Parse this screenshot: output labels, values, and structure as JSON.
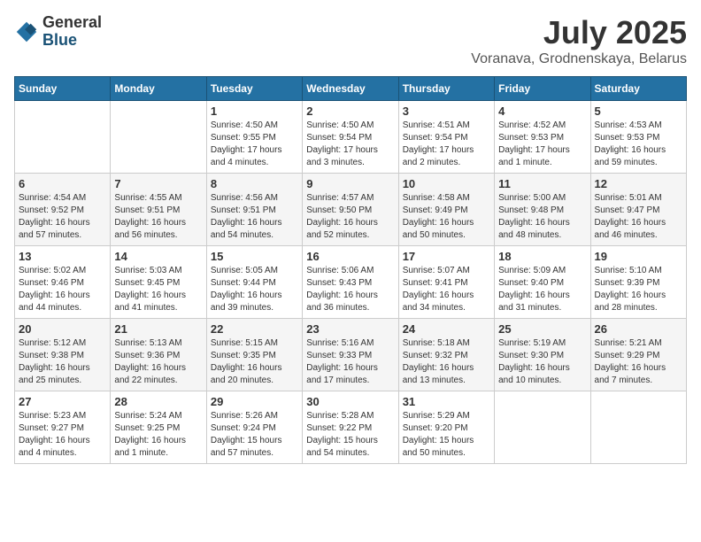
{
  "logo": {
    "general": "General",
    "blue": "Blue"
  },
  "title": "July 2025",
  "location": "Voranava, Grodnenskaya, Belarus",
  "weekdays": [
    "Sunday",
    "Monday",
    "Tuesday",
    "Wednesday",
    "Thursday",
    "Friday",
    "Saturday"
  ],
  "weeks": [
    [
      {
        "day": "",
        "info": ""
      },
      {
        "day": "",
        "info": ""
      },
      {
        "day": "1",
        "info": "Sunrise: 4:50 AM\nSunset: 9:55 PM\nDaylight: 17 hours\nand 4 minutes."
      },
      {
        "day": "2",
        "info": "Sunrise: 4:50 AM\nSunset: 9:54 PM\nDaylight: 17 hours\nand 3 minutes."
      },
      {
        "day": "3",
        "info": "Sunrise: 4:51 AM\nSunset: 9:54 PM\nDaylight: 17 hours\nand 2 minutes."
      },
      {
        "day": "4",
        "info": "Sunrise: 4:52 AM\nSunset: 9:53 PM\nDaylight: 17 hours\nand 1 minute."
      },
      {
        "day": "5",
        "info": "Sunrise: 4:53 AM\nSunset: 9:53 PM\nDaylight: 16 hours\nand 59 minutes."
      }
    ],
    [
      {
        "day": "6",
        "info": "Sunrise: 4:54 AM\nSunset: 9:52 PM\nDaylight: 16 hours\nand 57 minutes."
      },
      {
        "day": "7",
        "info": "Sunrise: 4:55 AM\nSunset: 9:51 PM\nDaylight: 16 hours\nand 56 minutes."
      },
      {
        "day": "8",
        "info": "Sunrise: 4:56 AM\nSunset: 9:51 PM\nDaylight: 16 hours\nand 54 minutes."
      },
      {
        "day": "9",
        "info": "Sunrise: 4:57 AM\nSunset: 9:50 PM\nDaylight: 16 hours\nand 52 minutes."
      },
      {
        "day": "10",
        "info": "Sunrise: 4:58 AM\nSunset: 9:49 PM\nDaylight: 16 hours\nand 50 minutes."
      },
      {
        "day": "11",
        "info": "Sunrise: 5:00 AM\nSunset: 9:48 PM\nDaylight: 16 hours\nand 48 minutes."
      },
      {
        "day": "12",
        "info": "Sunrise: 5:01 AM\nSunset: 9:47 PM\nDaylight: 16 hours\nand 46 minutes."
      }
    ],
    [
      {
        "day": "13",
        "info": "Sunrise: 5:02 AM\nSunset: 9:46 PM\nDaylight: 16 hours\nand 44 minutes."
      },
      {
        "day": "14",
        "info": "Sunrise: 5:03 AM\nSunset: 9:45 PM\nDaylight: 16 hours\nand 41 minutes."
      },
      {
        "day": "15",
        "info": "Sunrise: 5:05 AM\nSunset: 9:44 PM\nDaylight: 16 hours\nand 39 minutes."
      },
      {
        "day": "16",
        "info": "Sunrise: 5:06 AM\nSunset: 9:43 PM\nDaylight: 16 hours\nand 36 minutes."
      },
      {
        "day": "17",
        "info": "Sunrise: 5:07 AM\nSunset: 9:41 PM\nDaylight: 16 hours\nand 34 minutes."
      },
      {
        "day": "18",
        "info": "Sunrise: 5:09 AM\nSunset: 9:40 PM\nDaylight: 16 hours\nand 31 minutes."
      },
      {
        "day": "19",
        "info": "Sunrise: 5:10 AM\nSunset: 9:39 PM\nDaylight: 16 hours\nand 28 minutes."
      }
    ],
    [
      {
        "day": "20",
        "info": "Sunrise: 5:12 AM\nSunset: 9:38 PM\nDaylight: 16 hours\nand 25 minutes."
      },
      {
        "day": "21",
        "info": "Sunrise: 5:13 AM\nSunset: 9:36 PM\nDaylight: 16 hours\nand 22 minutes."
      },
      {
        "day": "22",
        "info": "Sunrise: 5:15 AM\nSunset: 9:35 PM\nDaylight: 16 hours\nand 20 minutes."
      },
      {
        "day": "23",
        "info": "Sunrise: 5:16 AM\nSunset: 9:33 PM\nDaylight: 16 hours\nand 17 minutes."
      },
      {
        "day": "24",
        "info": "Sunrise: 5:18 AM\nSunset: 9:32 PM\nDaylight: 16 hours\nand 13 minutes."
      },
      {
        "day": "25",
        "info": "Sunrise: 5:19 AM\nSunset: 9:30 PM\nDaylight: 16 hours\nand 10 minutes."
      },
      {
        "day": "26",
        "info": "Sunrise: 5:21 AM\nSunset: 9:29 PM\nDaylight: 16 hours\nand 7 minutes."
      }
    ],
    [
      {
        "day": "27",
        "info": "Sunrise: 5:23 AM\nSunset: 9:27 PM\nDaylight: 16 hours\nand 4 minutes."
      },
      {
        "day": "28",
        "info": "Sunrise: 5:24 AM\nSunset: 9:25 PM\nDaylight: 16 hours\nand 1 minute."
      },
      {
        "day": "29",
        "info": "Sunrise: 5:26 AM\nSunset: 9:24 PM\nDaylight: 15 hours\nand 57 minutes."
      },
      {
        "day": "30",
        "info": "Sunrise: 5:28 AM\nSunset: 9:22 PM\nDaylight: 15 hours\nand 54 minutes."
      },
      {
        "day": "31",
        "info": "Sunrise: 5:29 AM\nSunset: 9:20 PM\nDaylight: 15 hours\nand 50 minutes."
      },
      {
        "day": "",
        "info": ""
      },
      {
        "day": "",
        "info": ""
      }
    ]
  ]
}
